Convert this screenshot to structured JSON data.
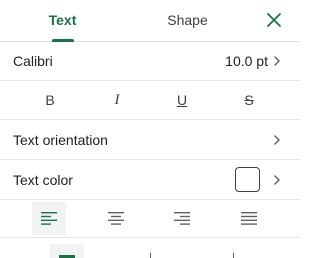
{
  "tabs": {
    "text_label": "Text",
    "shape_label": "Shape",
    "close_icon": "close-icon"
  },
  "font": {
    "name": "Calibri",
    "size": "10.0 pt"
  },
  "styles": {
    "bold": "B",
    "italic": "I",
    "underline": "U",
    "strikethrough": "S"
  },
  "text_orientation": {
    "label": "Text orientation"
  },
  "text_color": {
    "label": "Text color",
    "value": "#ffffff"
  },
  "alignment": {
    "selected": "left",
    "options": [
      "align-left-icon",
      "align-center-icon",
      "align-right-icon",
      "align-justify-icon"
    ]
  },
  "colors": {
    "accent": "#1e7145",
    "divider": "#e6e6e6",
    "selected_bg": "#f1f3f4"
  }
}
